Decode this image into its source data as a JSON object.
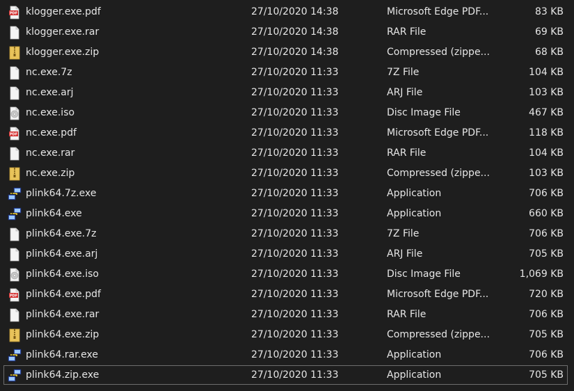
{
  "files": [
    {
      "name": "klogger.exe.pdf",
      "modified": "27/10/2020 14:38",
      "type": "Microsoft Edge PDF...",
      "size": "83 KB",
      "icon": "pdf-icon"
    },
    {
      "name": "klogger.exe.rar",
      "modified": "27/10/2020 14:38",
      "type": "RAR File",
      "size": "69 KB",
      "icon": "generic-file-icon"
    },
    {
      "name": "klogger.exe.zip",
      "modified": "27/10/2020 14:38",
      "type": "Compressed (zippe...",
      "size": "68 KB",
      "icon": "zip-folder-icon"
    },
    {
      "name": "nc.exe.7z",
      "modified": "27/10/2020 11:33",
      "type": "7Z File",
      "size": "104 KB",
      "icon": "generic-file-icon"
    },
    {
      "name": "nc.exe.arj",
      "modified": "27/10/2020 11:33",
      "type": "ARJ File",
      "size": "103 KB",
      "icon": "generic-file-icon"
    },
    {
      "name": "nc.exe.iso",
      "modified": "27/10/2020 11:33",
      "type": "Disc Image File",
      "size": "467 KB",
      "icon": "disc-image-icon"
    },
    {
      "name": "nc.exe.pdf",
      "modified": "27/10/2020 11:33",
      "type": "Microsoft Edge PDF...",
      "size": "118 KB",
      "icon": "pdf-icon"
    },
    {
      "name": "nc.exe.rar",
      "modified": "27/10/2020 11:33",
      "type": "RAR File",
      "size": "104 KB",
      "icon": "generic-file-icon"
    },
    {
      "name": "nc.exe.zip",
      "modified": "27/10/2020 11:33",
      "type": "Compressed (zippe...",
      "size": "103 KB",
      "icon": "zip-folder-icon"
    },
    {
      "name": "plink64.7z.exe",
      "modified": "27/10/2020 11:33",
      "type": "Application",
      "size": "706 KB",
      "icon": "plink-app-icon"
    },
    {
      "name": "plink64.exe",
      "modified": "27/10/2020 11:33",
      "type": "Application",
      "size": "660 KB",
      "icon": "plink-app-icon"
    },
    {
      "name": "plink64.exe.7z",
      "modified": "27/10/2020 11:33",
      "type": "7Z File",
      "size": "706 KB",
      "icon": "generic-file-icon"
    },
    {
      "name": "plink64.exe.arj",
      "modified": "27/10/2020 11:33",
      "type": "ARJ File",
      "size": "705 KB",
      "icon": "generic-file-icon"
    },
    {
      "name": "plink64.exe.iso",
      "modified": "27/10/2020 11:33",
      "type": "Disc Image File",
      "size": "1,069 KB",
      "icon": "disc-image-icon"
    },
    {
      "name": "plink64.exe.pdf",
      "modified": "27/10/2020 11:33",
      "type": "Microsoft Edge PDF...",
      "size": "720 KB",
      "icon": "pdf-icon"
    },
    {
      "name": "plink64.exe.rar",
      "modified": "27/10/2020 11:33",
      "type": "RAR File",
      "size": "706 KB",
      "icon": "generic-file-icon"
    },
    {
      "name": "plink64.exe.zip",
      "modified": "27/10/2020 11:33",
      "type": "Compressed (zippe...",
      "size": "705 KB",
      "icon": "zip-folder-icon"
    },
    {
      "name": "plink64.rar.exe",
      "modified": "27/10/2020 11:33",
      "type": "Application",
      "size": "706 KB",
      "icon": "plink-app-icon"
    },
    {
      "name": "plink64.zip.exe",
      "modified": "27/10/2020 11:33",
      "type": "Application",
      "size": "705 KB",
      "icon": "plink-app-icon",
      "selected": true
    }
  ],
  "colors": {
    "background": "#1e1e1e",
    "text": "#e6e6e6",
    "selection_border": "#6e6e6e",
    "pdf_red": "#d32f2f",
    "zip_yellow": "#e8c35a"
  }
}
